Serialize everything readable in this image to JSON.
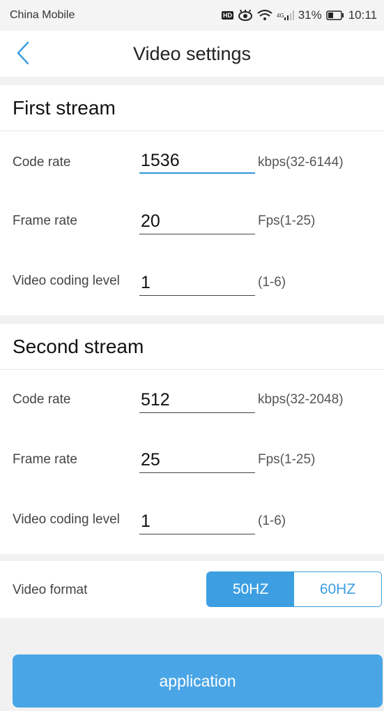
{
  "status_bar": {
    "carrier": "China Mobile",
    "hd_badge": "HD",
    "network": "4G",
    "battery": "31%",
    "time": "10:11"
  },
  "header": {
    "title": "Video settings",
    "back_icon": "chevron-left-icon"
  },
  "first_stream": {
    "title": "First stream",
    "code_rate": {
      "label": "Code rate",
      "value": "1536",
      "unit": "kbps(32-6144)"
    },
    "frame_rate": {
      "label": "Frame rate",
      "value": "20",
      "unit": "Fps(1-25)"
    },
    "coding_level": {
      "label": "Video coding level",
      "value": "1",
      "unit": "(1-6)"
    }
  },
  "second_stream": {
    "title": "Second stream",
    "code_rate": {
      "label": "Code rate",
      "value": "512",
      "unit": "kbps(32-2048)"
    },
    "frame_rate": {
      "label": "Frame rate",
      "value": "25",
      "unit": "Fps(1-25)"
    },
    "coding_level": {
      "label": "Video coding level",
      "value": "1",
      "unit": "(1-6)"
    }
  },
  "video_format": {
    "label": "Video format",
    "options": [
      "50HZ",
      "60HZ"
    ],
    "selected": "50HZ"
  },
  "apply_button": "application",
  "colors": {
    "accent": "#3d9fe2",
    "button": "#4aa5e6",
    "background_gap": "#f1f1f1"
  }
}
